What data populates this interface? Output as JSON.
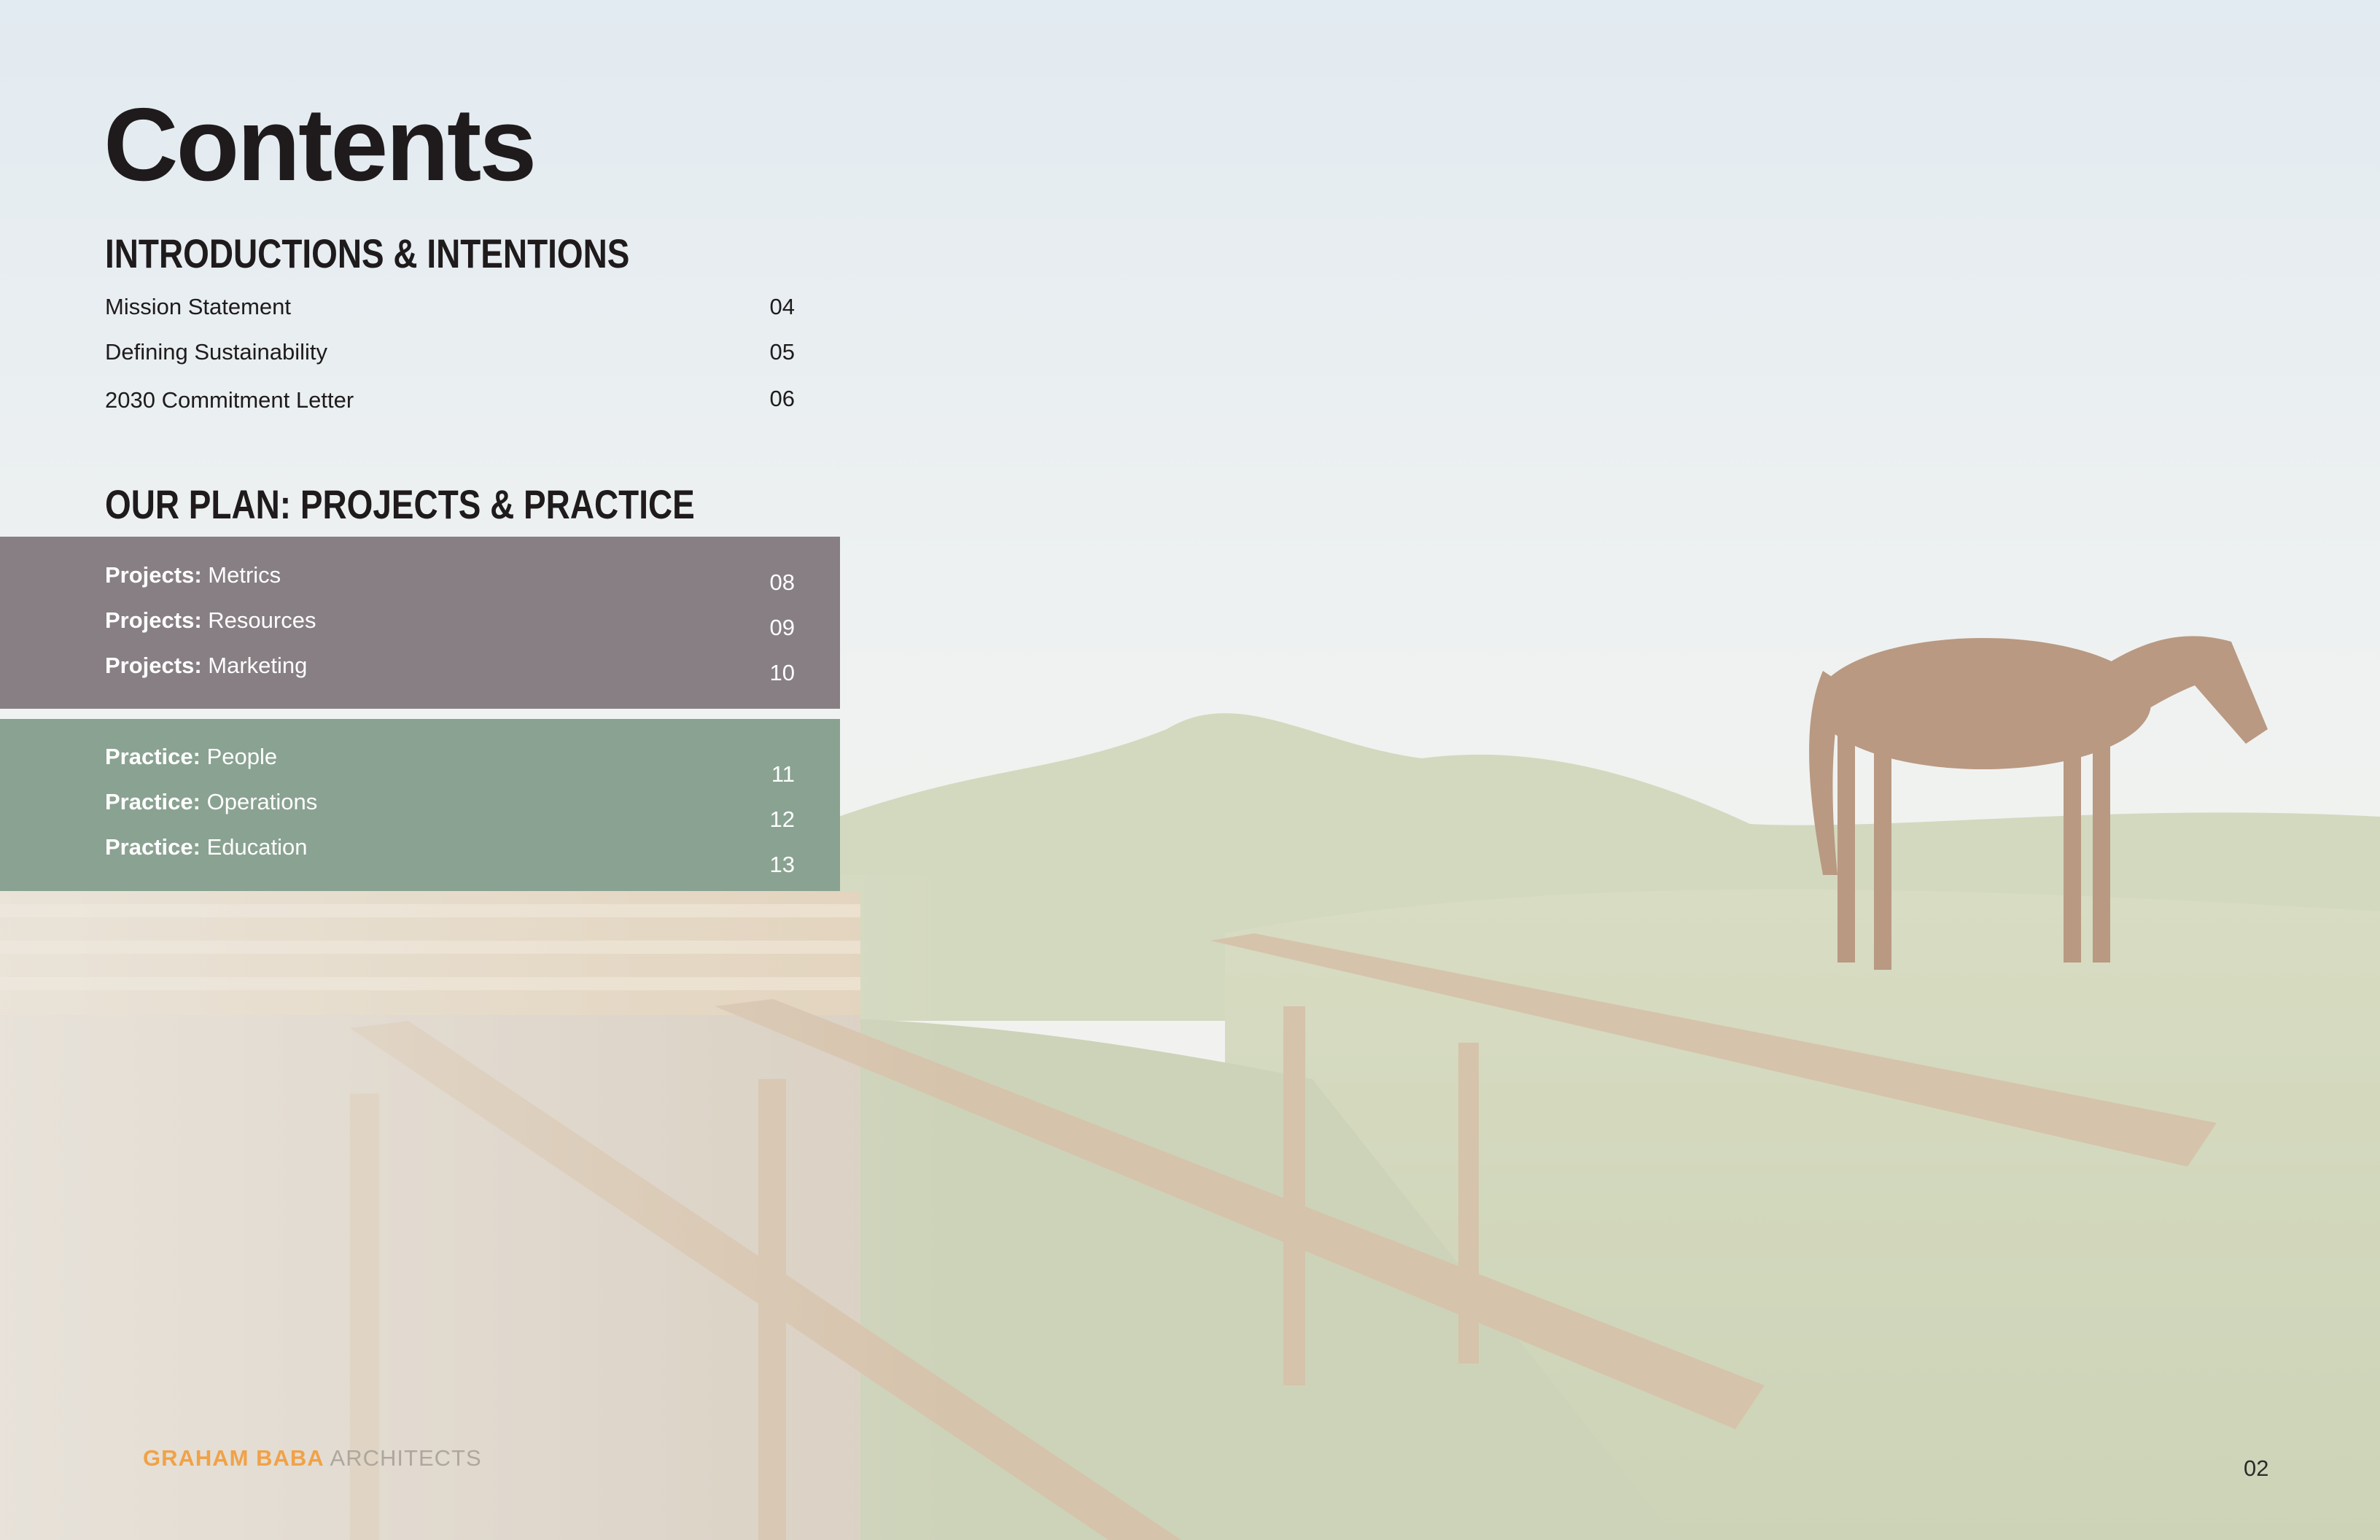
{
  "title": "Contents",
  "sections": {
    "intro": {
      "heading": "INTRODUCTIONS & INTENTIONS",
      "entries": [
        {
          "label": "Mission Statement",
          "page": "04"
        },
        {
          "label": "Defining Sustainability",
          "page": "05"
        },
        {
          "label": "2030 Commitment Letter",
          "page": "06"
        }
      ]
    },
    "plan": {
      "heading": "OUR PLAN: PROJECTS & PRACTICE",
      "projects": [
        {
          "prefix": "Projects:",
          "label": "Metrics",
          "page": "08"
        },
        {
          "prefix": "Projects:",
          "label": "Resources",
          "page": "09"
        },
        {
          "prefix": "Projects:",
          "label": "Marketing",
          "page": "10"
        }
      ],
      "practice": [
        {
          "prefix": "Practice:",
          "label": "People",
          "page": "11"
        },
        {
          "prefix": "Practice:",
          "label": "Operations",
          "page": "12"
        },
        {
          "prefix": "Practice:",
          "label": "Education",
          "page": "13"
        }
      ]
    }
  },
  "footer": {
    "brand_strong": "GRAHAM BABA",
    "brand_rest": " ARCHITECTS",
    "page_number": "02"
  },
  "colors": {
    "projects_band": "#877f83",
    "practice_band": "#8aa291",
    "brand_orange": "#f0a247",
    "title": "#1f1b1c"
  }
}
